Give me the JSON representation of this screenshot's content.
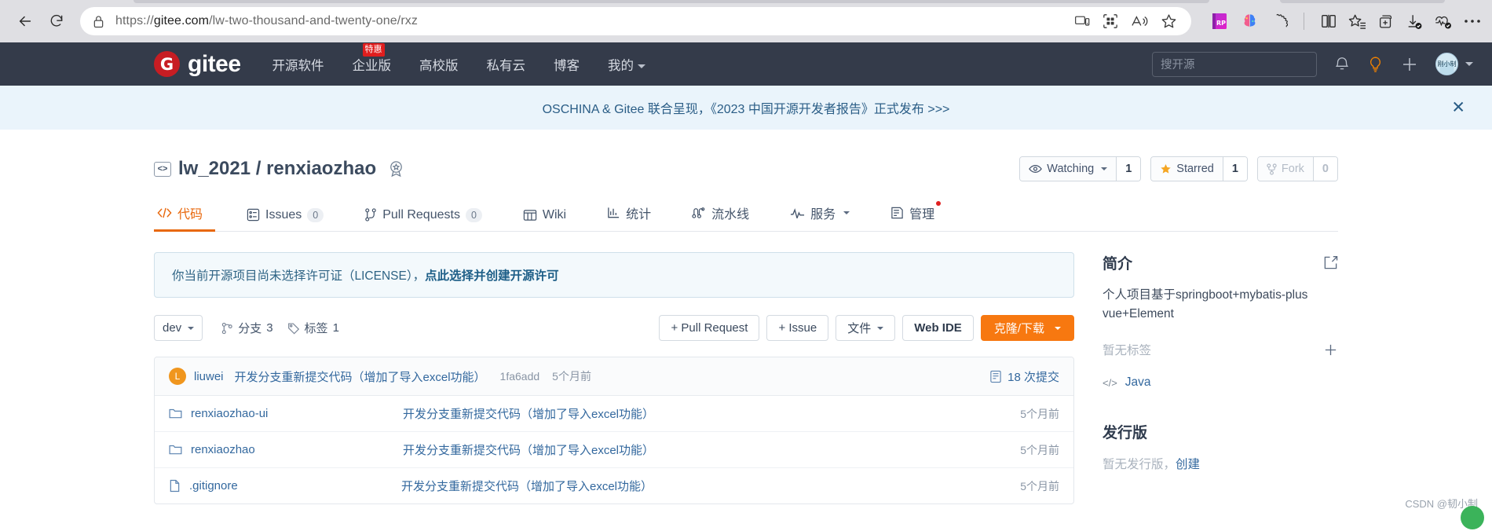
{
  "browser": {
    "url_prefix": "https://",
    "url_domain": "gitee.com",
    "url_path": "/lw-two-thousand-and-twenty-one/rxz",
    "back_label": "Back",
    "reload_label": "Refresh",
    "lock_icon": "lock-icon",
    "icons": {
      "cast": "device-cast-icon",
      "apps": "split-screen-apps-icon",
      "read_aloud": "read-aloud-icon",
      "favorite": "star-favorite-icon",
      "ext_rp": "rp-extension-icon",
      "ext_brain": "ai-brain-extension-icon",
      "ext_puzzle": "extensions-puzzle-icon",
      "split": "split-screen-icon",
      "collections": "collections-star-icon",
      "add_tab_group": "add-tab-group-icon",
      "downloads": "downloads-icon",
      "performance": "browser-essentials-icon",
      "settings": "more-settings-icon"
    }
  },
  "gitee_nav": {
    "logo_text": "gitee",
    "logo_mark": "G",
    "links": [
      {
        "label": "开源软件",
        "badge": ""
      },
      {
        "label": "企业版",
        "badge": "特惠"
      },
      {
        "label": "高校版",
        "badge": ""
      },
      {
        "label": "私有云",
        "badge": ""
      },
      {
        "label": "博客",
        "badge": ""
      },
      {
        "label": "我的",
        "badge": "",
        "has_caret": true
      }
    ],
    "search_placeholder": "搜开源",
    "bell_icon": "notification-bell-icon",
    "bulb_icon": "ideas-bulb-icon",
    "plus_icon": "create-new-icon",
    "avatar_label": "刚小制"
  },
  "announcement": {
    "text": "OSCHINA & Gitee 联合呈现，《2023 中国开源开发者报告》正式发布 >>>",
    "close_label": "✕"
  },
  "repo": {
    "owner": "lw_2021",
    "separator": "/",
    "name": "renxiaozhao",
    "code_icon": "code-brackets-icon",
    "medal_icon": "award-medal-icon",
    "actions": {
      "watching_label": "Watching",
      "watching_count": "1",
      "starred_label": "Starred",
      "starred_count": "1",
      "fork_label": "Fork",
      "fork_count": "0"
    },
    "tabs": [
      {
        "label": "代码",
        "icon": "code-icon",
        "count": "",
        "active": true
      },
      {
        "label": "Issues",
        "icon": "issues-icon",
        "count": "0",
        "active": false
      },
      {
        "label": "Pull Requests",
        "icon": "pull-request-icon",
        "count": "0",
        "active": false
      },
      {
        "label": "Wiki",
        "icon": "wiki-book-icon",
        "count": "",
        "active": false
      },
      {
        "label": "统计",
        "icon": "stats-chart-icon",
        "count": "",
        "active": false
      },
      {
        "label": "流水线",
        "icon": "pipeline-icon",
        "count": "",
        "active": false
      },
      {
        "label": "服务",
        "icon": "services-icon",
        "count": "",
        "active": false,
        "caret": true
      },
      {
        "label": "管理",
        "icon": "manage-icon",
        "count": "",
        "active": false,
        "dot": true
      }
    ]
  },
  "license_notice": {
    "text": "你当前开源项目尚未选择许可证（LICENSE），",
    "link": "点此选择并创建开源许可"
  },
  "toolbar": {
    "branch": "dev",
    "branches_label": "分支",
    "branches_count": "3",
    "tags_label": "标签",
    "tags_count": "1",
    "pull_request_btn": "+ Pull Request",
    "issue_btn": "+ Issue",
    "files_btn": "文件",
    "webide_btn": "Web IDE",
    "clone_btn": "克隆/下载"
  },
  "commit": {
    "avatar_letter": "L",
    "author": "liuwei",
    "message": "开发分支重新提交代码（增加了导入excel功能）",
    "sha": "1fa6add",
    "time": "5个月前",
    "count_label": "18 次提交",
    "commits_icon": "commit-history-icon"
  },
  "files": [
    {
      "icon": "folder-icon",
      "name": "renxiaozhao-ui",
      "message": "开发分支重新提交代码（增加了导入excel功能）",
      "time": "5个月前"
    },
    {
      "icon": "folder-icon",
      "name": "renxiaozhao",
      "message": "开发分支重新提交代码（增加了导入excel功能）",
      "time": "5个月前"
    },
    {
      "icon": "file-icon",
      "name": ".gitignore",
      "message": "开发分支重新提交代码（增加了导入excel功能）",
      "time": "5个月前"
    }
  ],
  "sidebar": {
    "about_title": "简介",
    "about_edit_icon": "edit-pencil-icon",
    "description": "个人项目基于springboot+mybatis-plus vue+Element",
    "no_tags": "暂无标签",
    "add_tag_icon": "plus-icon",
    "language": "Java",
    "language_icon": "code-brackets-icon",
    "releases_title": "发行版",
    "no_releases": "暂无发行版，",
    "create_release": "创建"
  },
  "watermark": "CSDN @韧小制"
}
